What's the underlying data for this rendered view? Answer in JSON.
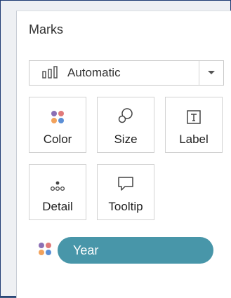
{
  "marks": {
    "title": "Marks",
    "mark_type": "Automatic",
    "cards": [
      {
        "label": "Color"
      },
      {
        "label": "Size"
      },
      {
        "label": "Label"
      },
      {
        "label": "Detail"
      },
      {
        "label": "Tooltip"
      }
    ],
    "pill": {
      "label": "Year"
    }
  },
  "colors": {
    "pill": "#4896a9",
    "dot_purple": "#8b6fb5",
    "dot_red": "#e07a7a",
    "dot_orange": "#f2a25c",
    "dot_blue": "#5b8fd6"
  }
}
